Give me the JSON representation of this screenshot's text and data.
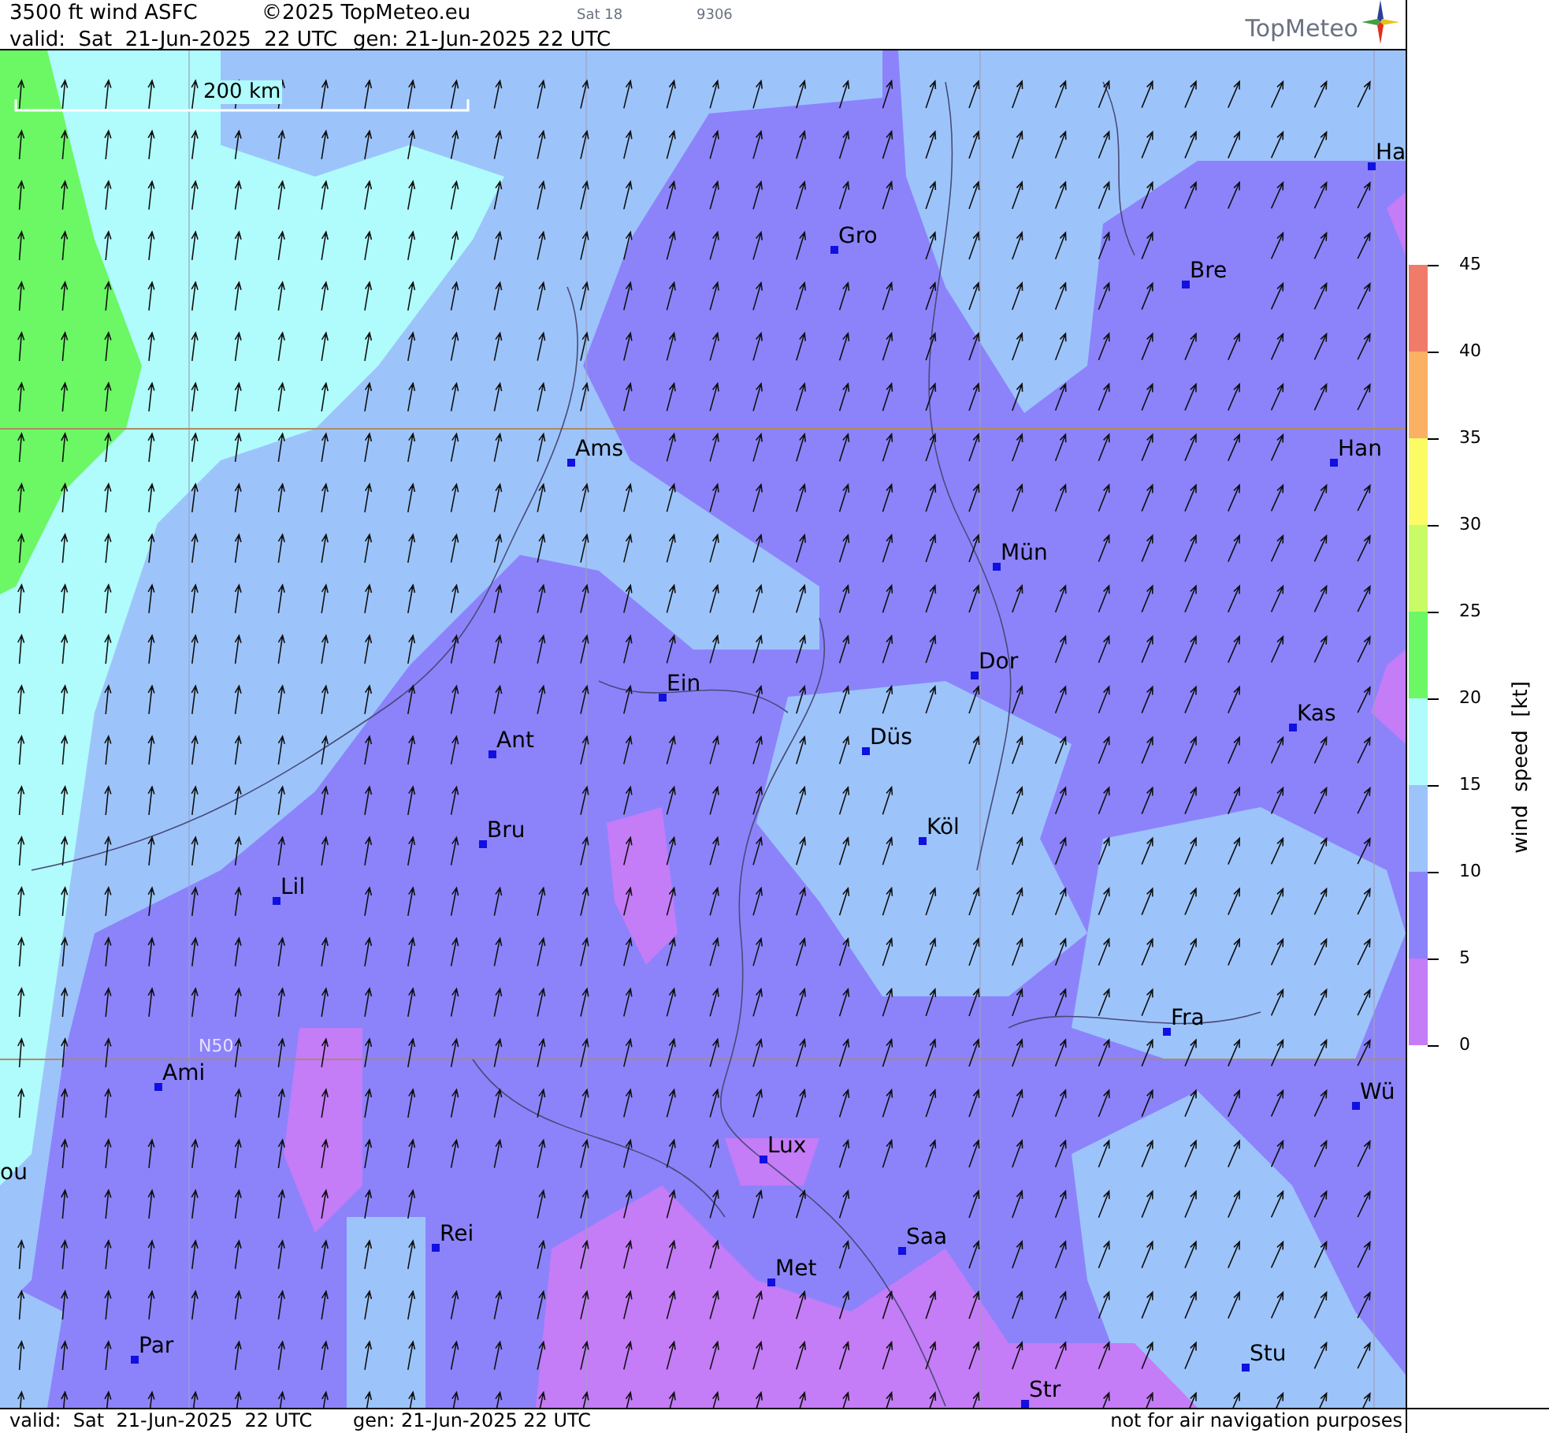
{
  "header": {
    "title": "3500 ft wind ASFC",
    "copyright": "©2025 TopMeteo.eu",
    "run": "Sat 18",
    "code": "9306",
    "valid": "valid:  Sat  21-Jun-2025  22 UTC",
    "generated": "gen: 21-Jun-2025 22 UTC",
    "logo": "TopMeteo"
  },
  "map": {
    "scale_label": "200 km",
    "latitude_label": "N50",
    "cities": [
      {
        "name": "Ha"
      },
      {
        "name": "Gro"
      },
      {
        "name": "Bre"
      },
      {
        "name": "Ams"
      },
      {
        "name": "Han"
      },
      {
        "name": "Mün"
      },
      {
        "name": "Dor"
      },
      {
        "name": "Ein"
      },
      {
        "name": "Kas"
      },
      {
        "name": "Ant"
      },
      {
        "name": "Düs"
      },
      {
        "name": "Köl"
      },
      {
        "name": "Bru"
      },
      {
        "name": "Lil"
      },
      {
        "name": "Fra"
      },
      {
        "name": "Ami"
      },
      {
        "name": "Wü"
      },
      {
        "name": "Lux"
      },
      {
        "name": "ou"
      },
      {
        "name": "Rei"
      },
      {
        "name": "Saa"
      },
      {
        "name": "Met"
      },
      {
        "name": "Par"
      },
      {
        "name": "Stu"
      },
      {
        "name": "Str"
      }
    ]
  },
  "legend": {
    "title": "wind  speed  [kt]",
    "ticks": [
      "45",
      "40",
      "35",
      "30",
      "25",
      "20",
      "15",
      "10",
      "5",
      "0"
    ],
    "bands": [
      {
        "color": "#f07b69"
      },
      {
        "color": "#fbb064"
      },
      {
        "color": "#fbfb64"
      },
      {
        "color": "#c8fb64"
      },
      {
        "color": "#6cf765"
      },
      {
        "color": "#b0fbfb"
      },
      {
        "color": "#9cc4fb"
      },
      {
        "color": "#8c83fb"
      },
      {
        "color": "#c47cf7"
      }
    ]
  },
  "footer": {
    "valid": "valid:  Sat  21-Jun-2025  22 UTC",
    "generated": "gen: 21-Jun-2025 22 UTC",
    "disclaimer": "not for air navigation purposes"
  }
}
